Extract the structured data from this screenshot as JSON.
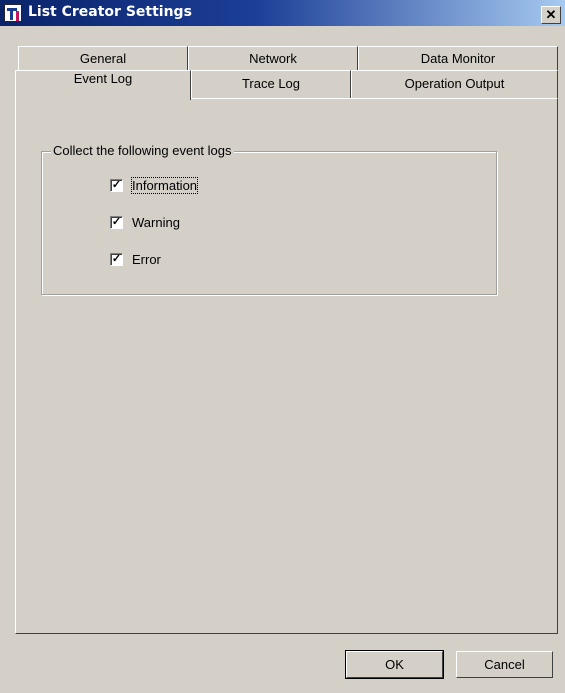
{
  "window": {
    "title": "List Creator Settings",
    "close_glyph": "✕"
  },
  "tabs": {
    "row1": [
      "General",
      "Network",
      "Data Monitor"
    ],
    "row2": [
      "Event Log",
      "Trace Log",
      "Operation Output"
    ],
    "active": "Event Log"
  },
  "event_log": {
    "group_title": "Collect the following event logs",
    "options": [
      {
        "label": "Information",
        "checked": true,
        "mark": "✓"
      },
      {
        "label": "Warning",
        "checked": true,
        "mark": "✓"
      },
      {
        "label": "Error",
        "checked": true,
        "mark": "✓"
      }
    ]
  },
  "buttons": {
    "ok": "OK",
    "cancel": "Cancel"
  }
}
